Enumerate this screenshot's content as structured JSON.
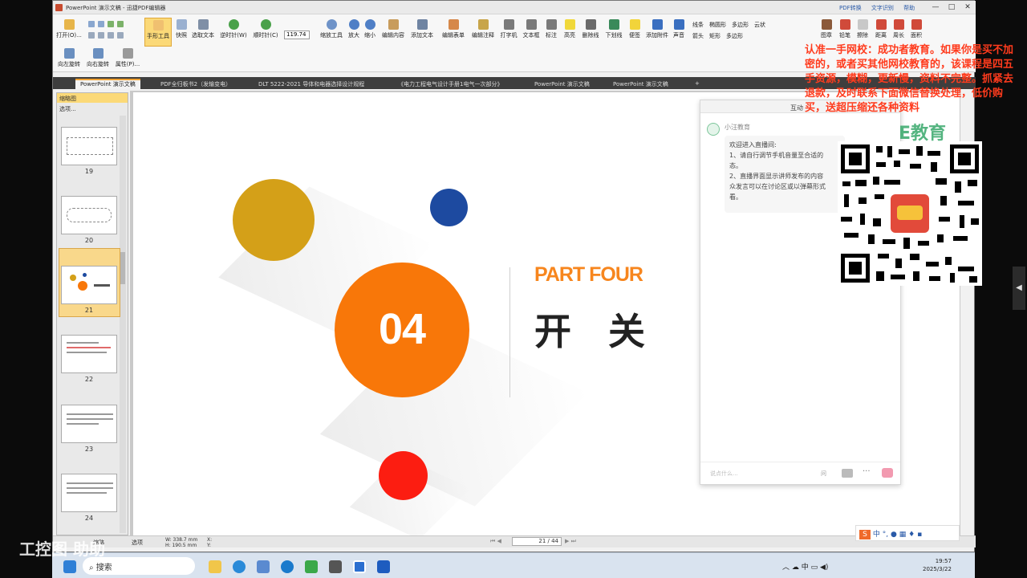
{
  "window": {
    "title": "PowerPoint 演示文稿 - 迅捷PDF编辑器",
    "header_links": [
      "PDF转换",
      "文字识别",
      "帮助"
    ],
    "min": "—",
    "max": "□",
    "close": "✕"
  },
  "ribbon": {
    "buttons": [
      "打开(O)...",
      "手形工具",
      "快照",
      "选取文本",
      "逆时针(W)",
      "顺时针(C)",
      "缩放工具",
      "放大",
      "缩小",
      "编辑内容",
      "添加文本",
      "编辑表单",
      "编辑注释",
      "打字机",
      "文本框",
      "标注",
      "高亮",
      "删除线",
      "下划线",
      "便签",
      "添加附件",
      "声音",
      "图章",
      "铅笔",
      "擦除",
      "距离",
      "周长",
      "面积",
      "向左旋转",
      "向右旋转",
      "属性(P)..."
    ],
    "zoom_value": "119.74",
    "shapes": [
      "线条",
      "椭圆形",
      "多边形",
      "云状",
      "箭头",
      "矩形",
      "多边形"
    ]
  },
  "tabs": [
    {
      "label": "PowerPoint 演示文稿",
      "active": true
    },
    {
      "label": "PDF全归板书2（发输变电）",
      "active": false
    },
    {
      "label": "DLT 5222-2021 导体和电器选择设计规程",
      "active": false
    },
    {
      "label": "《电力工程电气设计手册1电气一次部分》",
      "active": false
    },
    {
      "label": "PowerPoint 演示文稿",
      "active": false
    },
    {
      "label": "PowerPoint 演示文稿",
      "active": false
    }
  ],
  "thumbs": {
    "title": "缩略图",
    "options": "选项...",
    "pages": [
      "19",
      "20",
      "21",
      "22",
      "23",
      "24"
    ],
    "selected": "21"
  },
  "slide": {
    "part": "PART FOUR",
    "number": "04",
    "heading": "开　关",
    "colors": {
      "gold": "#d4a018",
      "navy": "#1d4aa0",
      "orange": "#f87709",
      "red": "#fc1d11",
      "part": "#f7861e"
    }
  },
  "chat": {
    "title": "互动",
    "sender": "小汪教育",
    "greeting": "欢迎进入直播间:",
    "line1": "1、请自行调节手机音量至合适的",
    "line1b": "态。",
    "line2": "2、直播界面显示讲师发布的内容",
    "line2b": "众发言可以在讨论区或以弹幕形式",
    "line2c": "看。",
    "input_placeholder": "说点什么...",
    "send_label": "问"
  },
  "overlay": {
    "text": "认准一手网校：成功者教育。如果你是买不加密的，或者买其他网校教育的，该课程是四五手资源，模糊，更新慢，资料不完整。抓紧去退款，及时联系下面微信替换处理，低价购买，送超压缩还各种资料",
    "logo": "E教育"
  },
  "statusbar": {
    "thumb_label": "缩略",
    "select_label": "选项",
    "w": "W: 338.7 mm",
    "h": "H: 190.5 mm",
    "x": "X:",
    "y": "Y:",
    "page": "21 / 44"
  },
  "taskbar": {
    "search": "搜索",
    "ime": "中",
    "time": "19:57",
    "date": "2025/3/22"
  },
  "watermark": "工控图 助助",
  "sidebar_arrow": "◀"
}
